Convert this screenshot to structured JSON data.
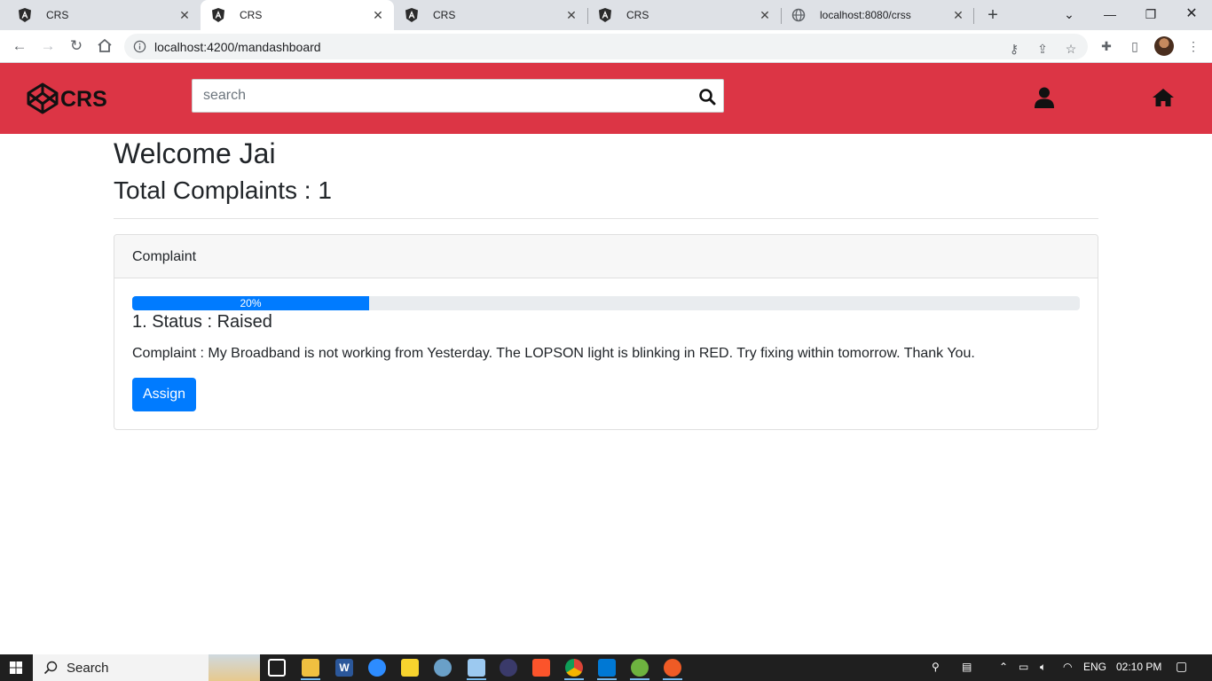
{
  "browser": {
    "tabs": [
      {
        "title": "CRS",
        "active": false
      },
      {
        "title": "CRS",
        "active": true
      },
      {
        "title": "CRS",
        "active": false
      },
      {
        "title": "CRS",
        "active": false
      },
      {
        "title": "localhost:8080/crss",
        "active": false
      }
    ],
    "url": "localhost:4200/mandashboard"
  },
  "navbar": {
    "logo_text": "CRS",
    "search_placeholder": "search",
    "accent_color": "#dc3545"
  },
  "main": {
    "welcome": "Welcome Jai",
    "total_complaints": "Total Complaints : 1"
  },
  "card": {
    "header": "Complaint",
    "progress_percent": 20,
    "progress_label": "20%",
    "status": "1. Status : Raised",
    "complaint_text": "Complaint : My Broadband is not working from Yesterday. The LOPSON light is blinking in RED. Try fixing within tomorrow. Thank You.",
    "assign_label": "Assign"
  },
  "taskbar": {
    "search_label": "Search",
    "language": "ENG",
    "time": "02:10 PM"
  }
}
